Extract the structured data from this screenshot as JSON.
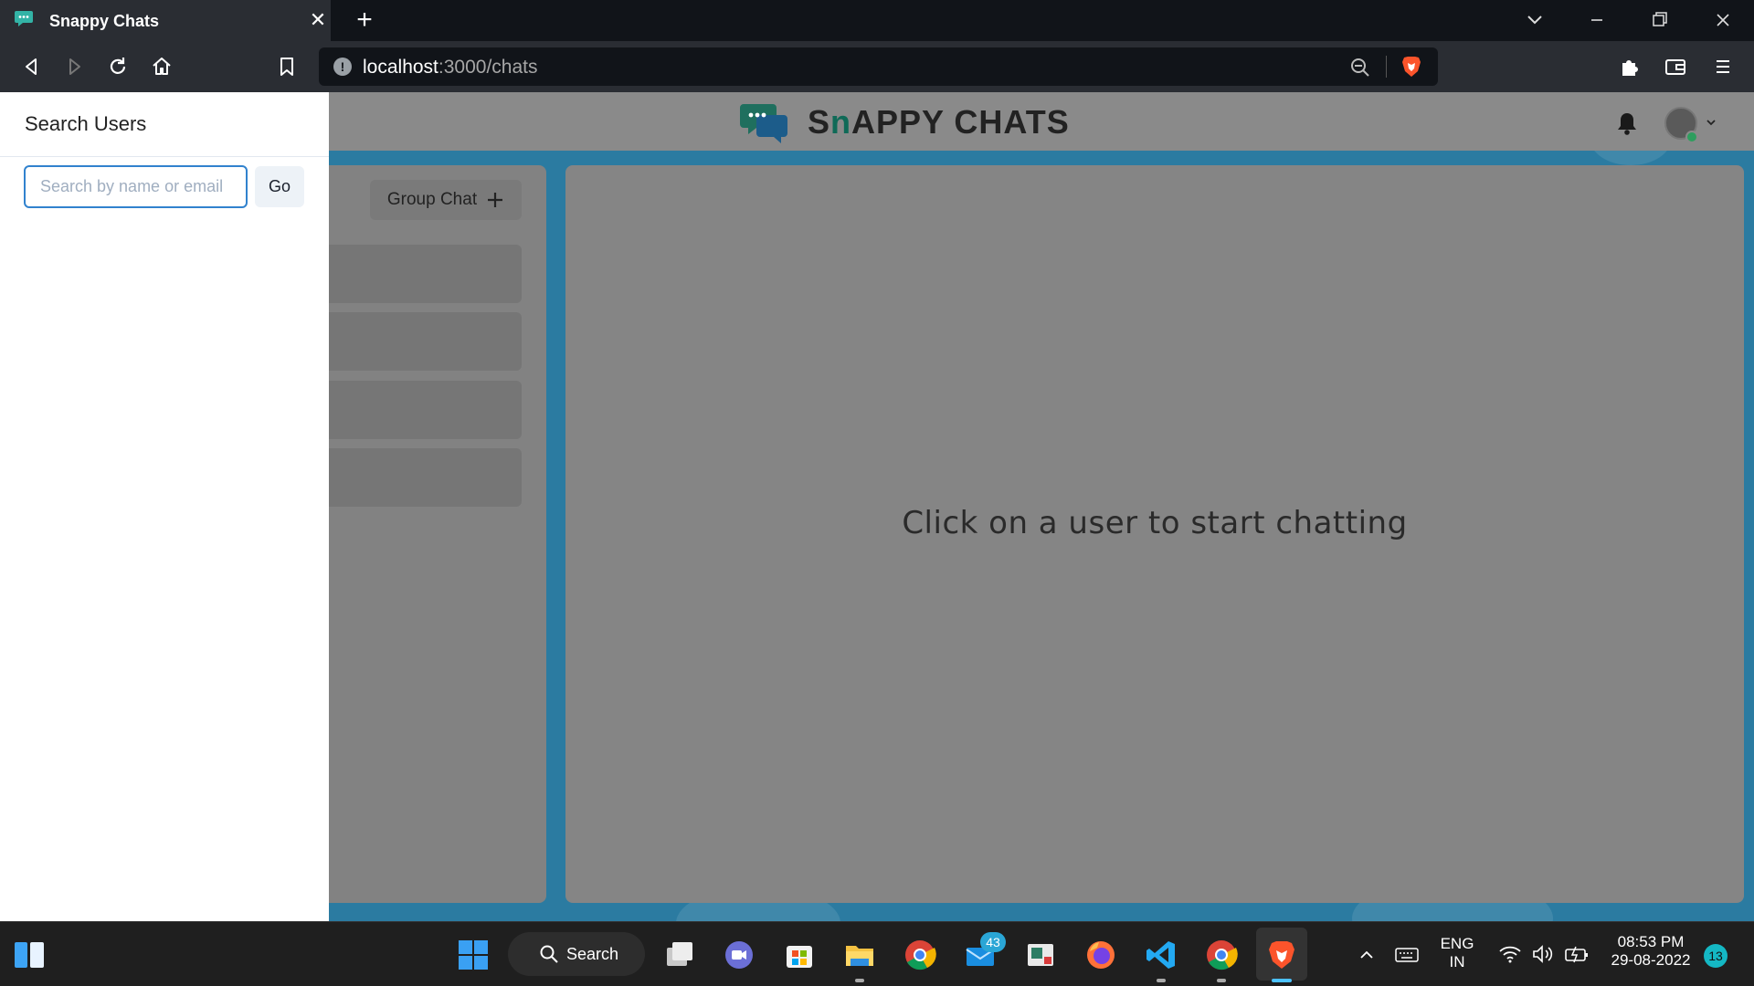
{
  "browser": {
    "tab_title": "Snappy Chats",
    "url_host": "localhost",
    "url_path": ":3000/chats"
  },
  "app": {
    "brand_first": "S",
    "brand_accent": "n",
    "brand_rest": "APPY CHATS",
    "group_chat_label": "Group Chat",
    "empty_message": "Click on a user to start chatting"
  },
  "drawer": {
    "title": "Search Users",
    "search_placeholder": "Search by name or email",
    "search_value": "",
    "go_label": "Go"
  },
  "taskbar": {
    "search_label": "Search",
    "mail_badge": "43",
    "lang_line1": "ENG",
    "lang_line2": "IN",
    "time": "08:53 PM",
    "date": "29-08-2022",
    "notification_count": "13"
  },
  "colors": {
    "page_bg": "#2b7ba1",
    "brand_accent": "#0f6a57",
    "input_focus": "#3182ce",
    "overlay_gray": "#858585"
  }
}
